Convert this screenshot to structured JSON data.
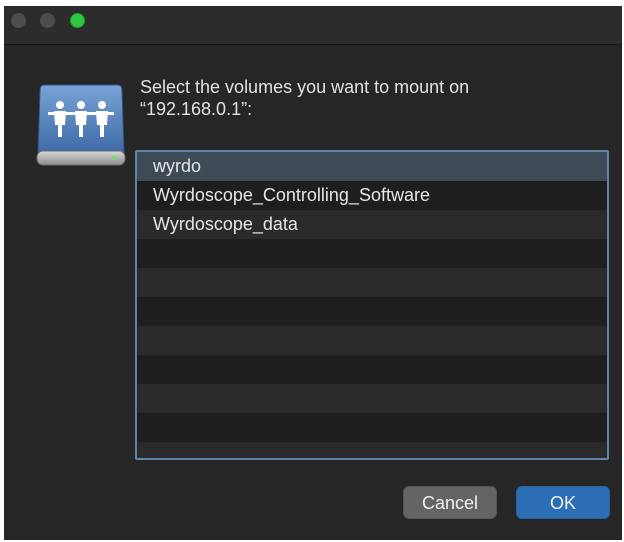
{
  "window": {
    "traffic_lights": [
      "close",
      "minimize",
      "zoom"
    ]
  },
  "dialog": {
    "icon": "network-share-drive-icon",
    "prompt_line1": "Select the volumes you want to mount on",
    "prompt_line2": "“192.168.0.1”:",
    "volumes": [
      {
        "label": "wyrdo",
        "selected": true
      },
      {
        "label": "Wyrdoscope_Controlling_Software",
        "selected": false
      },
      {
        "label": "Wyrdoscope_data",
        "selected": false
      }
    ],
    "cancel_label": "Cancel",
    "ok_label": "OK"
  },
  "colors": {
    "window_bg": "#262626",
    "accent_blue": "#2c6fb6",
    "list_border": "#5f85ac",
    "zoom_green": "#2bc840"
  }
}
